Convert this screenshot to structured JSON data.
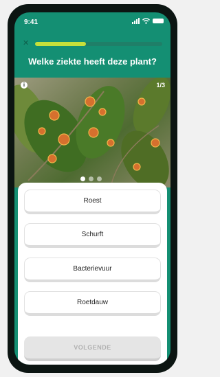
{
  "status_bar": {
    "time": "9:41"
  },
  "quiz": {
    "progress_fraction": 0.4,
    "question": "Welke ziekte heeft deze plant?",
    "image_counter": "1/3",
    "image_count": 3,
    "active_image_index": 0
  },
  "options": [
    {
      "label": "Roest"
    },
    {
      "label": "Schurft"
    },
    {
      "label": "Bacterievuur"
    },
    {
      "label": "Roetdauw"
    }
  ],
  "next_button": {
    "label": "VOLGENDE"
  },
  "colors": {
    "brand_green": "#148f73",
    "progress_accent": "#c6e03a",
    "leaf_spot": "#d6702e"
  },
  "icons": [
    "close-icon",
    "info-icon",
    "signal-icon",
    "wifi-icon",
    "battery-icon"
  ]
}
